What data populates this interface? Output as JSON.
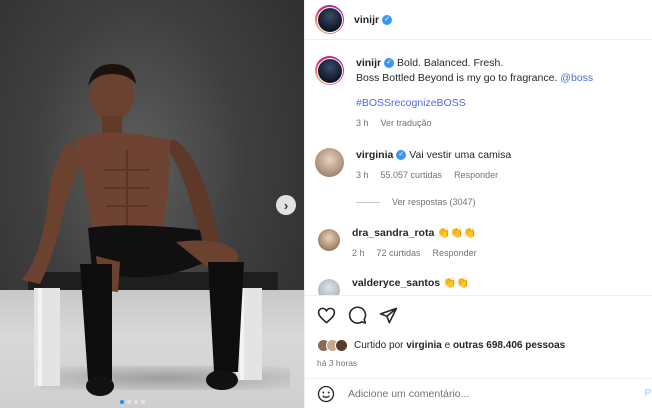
{
  "post": {
    "author": "vinijr",
    "verified": true,
    "caption": {
      "line1": "Bold. Balanced. Fresh.",
      "line2": "Boss Bottled Beyond is my go to fragrance.",
      "mention": "@boss",
      "hashtag": "#BOSSrecognizeBOSS",
      "time": "3 h",
      "translate": "Ver tradução"
    }
  },
  "comments": [
    {
      "user": "virginia",
      "verified": true,
      "text": "Vai vestir uma camisa",
      "time": "3 h",
      "likes": "55.057 curtidas",
      "reply": "Responder",
      "view_replies": "Ver respostas (3047)"
    },
    {
      "user": "dra_sandra_rota",
      "verified": false,
      "text": "👏👏👏",
      "time": "2 h",
      "likes": "72 curtidas",
      "reply": "Responder"
    },
    {
      "user": "valderyce_santos",
      "verified": false,
      "text": "👏👏"
    }
  ],
  "likes": {
    "prefix": "Curtido por",
    "user": "virginia",
    "middle": "e",
    "others": "outras 698.406 pessoas"
  },
  "posted_ago": "há 3 horas",
  "add_comment": {
    "placeholder": "Adicione um comentário...",
    "post_label": "P"
  },
  "icons": [
    "heart-icon",
    "comment-icon",
    "share-icon",
    "emoji-icon",
    "chevron-right-icon",
    "verified-icon"
  ],
  "colors": {
    "verified": "#3797f0",
    "link": "#00376b",
    "mention": "#4f6bd7",
    "carousel_active": "#1a8cff"
  }
}
